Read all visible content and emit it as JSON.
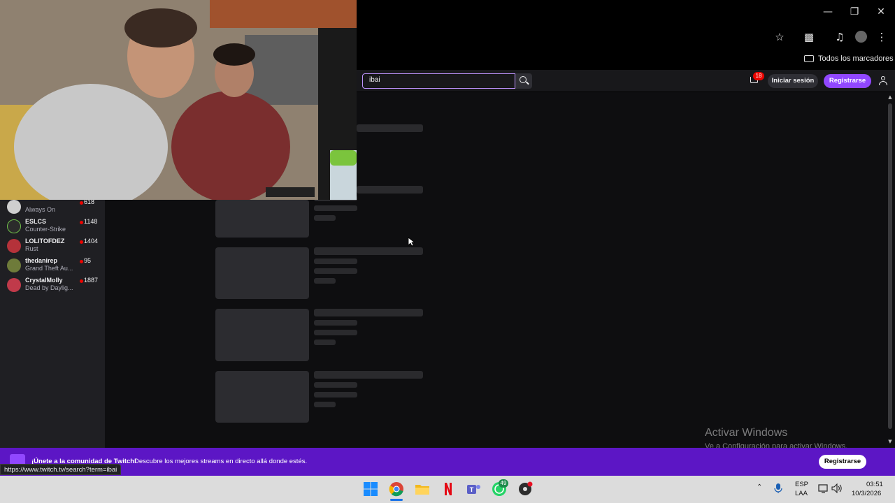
{
  "browser": {
    "bookmarks_label": "Todos los marcadores",
    "window_controls": [
      "minimize-icon",
      "restore-icon",
      "close-icon"
    ],
    "toolbar_icons": [
      "star-icon",
      "extensions-icon",
      "media-control-icon",
      "profile-avatar",
      "kebab-menu-icon"
    ],
    "status_url": "https://www.twitch.tv/search?term=ibai"
  },
  "twitch": {
    "search_value": "ibai",
    "inbox_badge": "18",
    "login_label": "Iniciar sesión",
    "signup_label": "Registrarse",
    "accent": "#9147ff"
  },
  "sidebar": {
    "channels": [
      {
        "name": "",
        "game": "Always On",
        "viewers": "618",
        "avatar_color": "#cfcfcf"
      },
      {
        "name": "ESLCS",
        "game": "Counter-Strike",
        "viewers": "1148",
        "avatar_color": "#2b2b2b"
      },
      {
        "name": "LOLITOFDEZ",
        "game": "Rust",
        "viewers": "1404",
        "avatar_color": "#b5323a"
      },
      {
        "name": "thedanirep",
        "game": "Grand Theft Au...",
        "viewers": "95",
        "avatar_color": "#6e7b3a"
      },
      {
        "name": "CrystalMolly",
        "game": "Dead by Daylig...",
        "viewers": "1887",
        "avatar_color": "#c03a4a"
      }
    ]
  },
  "watermark": {
    "title": "Activar Windows",
    "subtitle": "Ve a Configuración para activar Windows."
  },
  "banner": {
    "title": "¡Únete a la comunidad de Twitch!",
    "text": "Descubre los mejores streams en directo allá donde estés.",
    "button": "Registrarse",
    "color": "#5c16c5"
  },
  "taskbar": {
    "apps": [
      "windows-start-icon",
      "chrome-icon",
      "file-explorer-icon",
      "netflix-icon",
      "teams-icon",
      "whatsapp-icon",
      "obs-icon"
    ],
    "whatsapp_badge": "49",
    "lang_line1": "ESP",
    "lang_line2": "LAA",
    "time": "03:51",
    "date": "10/3/2026"
  }
}
